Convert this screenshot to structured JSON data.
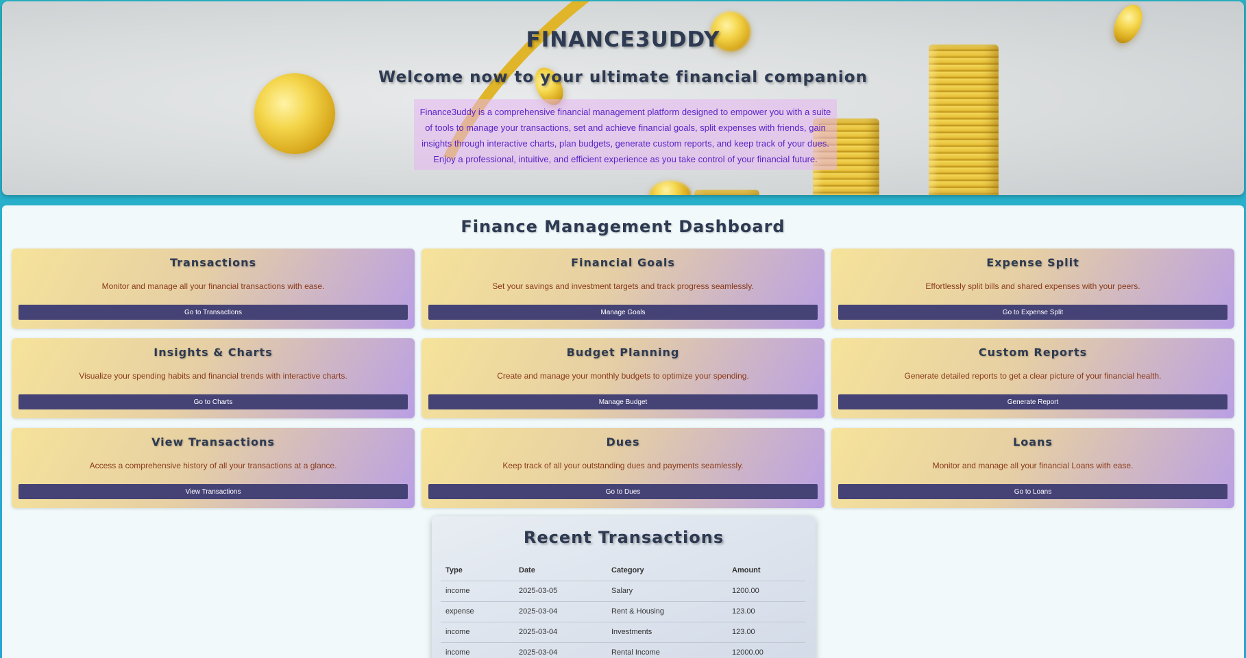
{
  "hero": {
    "title": "FINANCE3UDDY",
    "subtitle": "Welcome now to your ultimate financial companion",
    "description": "Finance3uddy is a comprehensive financial management platform designed to empower you with a suite of tools to manage your transactions, set and achieve financial goals, split expenses with friends, gain insights through interactive charts, plan budgets, generate custom reports, and keep track of your dues. Enjoy a professional, intuitive, and efficient experience as you take control of your financial future."
  },
  "dashboard": {
    "title": "Finance Management Dashboard",
    "cards": [
      {
        "title": "Transactions",
        "description": "Monitor and manage all your financial transactions with ease.",
        "button": "Go to Transactions"
      },
      {
        "title": "Financial Goals",
        "description": "Set your savings and investment targets and track progress seamlessly.",
        "button": "Manage Goals"
      },
      {
        "title": "Expense Split",
        "description": "Effortlessly split bills and shared expenses with your peers.",
        "button": "Go to Expense Split"
      },
      {
        "title": "Insights & Charts",
        "description": "Visualize your spending habits and financial trends with interactive charts.",
        "button": "Go to Charts"
      },
      {
        "title": "Budget Planning",
        "description": "Create and manage your monthly budgets to optimize your spending.",
        "button": "Manage Budget"
      },
      {
        "title": "Custom Reports",
        "description": "Generate detailed reports to get a clear picture of your financial health.",
        "button": "Generate Report"
      },
      {
        "title": "View Transactions",
        "description": "Access a comprehensive history of all your transactions at a glance.",
        "button": "View Transactions"
      },
      {
        "title": "Dues",
        "description": "Keep track of all your outstanding dues and payments seamlessly.",
        "button": "Go to Dues"
      },
      {
        "title": "Loans",
        "description": "Monitor and manage all your financial Loans with ease.",
        "button": "Go to Loans"
      }
    ]
  },
  "recent": {
    "title": "Recent Transactions",
    "columns": [
      "Type",
      "Date",
      "Category",
      "Amount"
    ],
    "rows": [
      [
        "income",
        "2025-03-05",
        "Salary",
        "1200.00"
      ],
      [
        "expense",
        "2025-03-04",
        "Rent & Housing",
        "123.00"
      ],
      [
        "income",
        "2025-03-04",
        "Investments",
        "123.00"
      ],
      [
        "income",
        "2025-03-04",
        "Rental Income",
        "12000.00"
      ]
    ]
  },
  "colors": {
    "accent_button": "#454276",
    "heading": "#2d3a52",
    "description_text": "#5b23c9",
    "card_text": "#8a3a1a"
  },
  "icons": [
    "gold-coin-icon",
    "coin-stack-icon"
  ]
}
